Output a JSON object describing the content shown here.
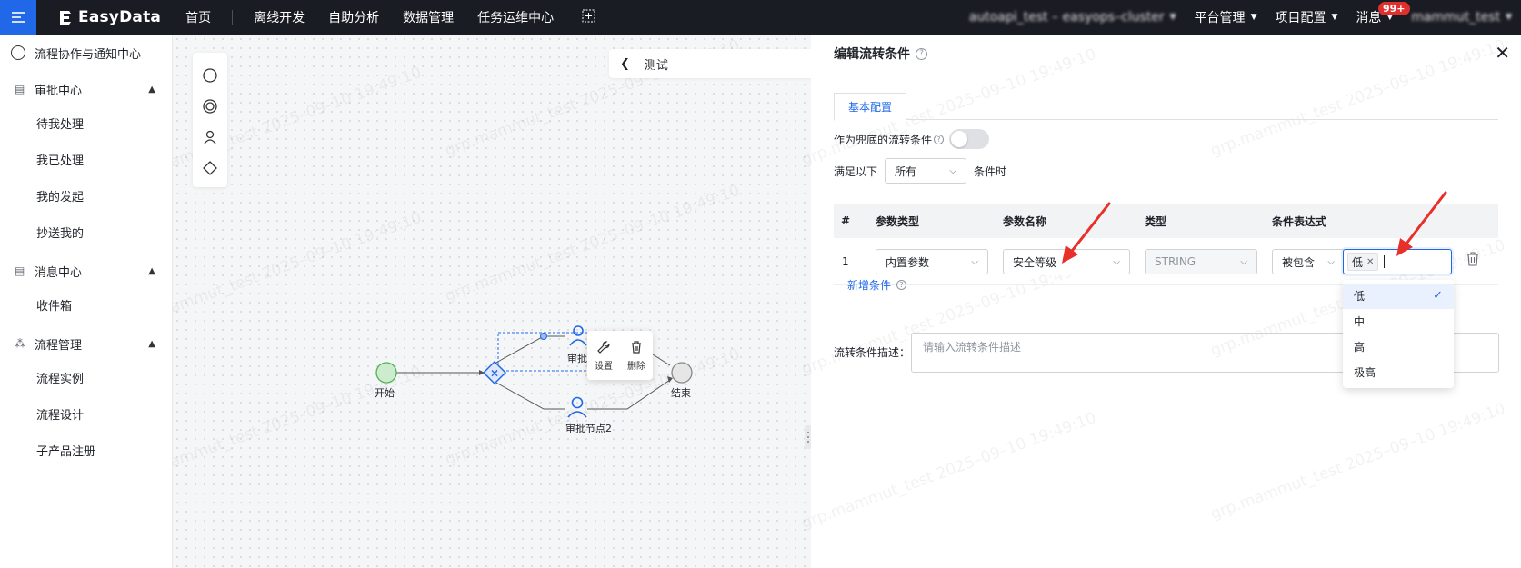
{
  "topbar": {
    "logo": "EasyData",
    "nav": [
      "首页",
      "离线开发",
      "自助分析",
      "数据管理",
      "任务运维中心"
    ],
    "cluster": "autoapi_test – easyops–cluster",
    "platform_admin": "平台管理",
    "project_config": "项目配置",
    "messages": "消息",
    "badge": "99+",
    "user": "mammut_test"
  },
  "sidebar": {
    "header": "流程协作与通知中心",
    "groups": [
      {
        "label": "审批中心",
        "items": [
          "待我处理",
          "我已处理",
          "我的发起",
          "抄送我的"
        ]
      },
      {
        "label": "消息中心",
        "items": [
          "收件箱"
        ]
      },
      {
        "label": "流程管理",
        "items": [
          "流程实例",
          "流程设计",
          "子产品注册"
        ]
      }
    ]
  },
  "canvas": {
    "test_label": "测试",
    "nodes": {
      "start": "开始",
      "end": "结束",
      "approval1": "审批",
      "approval2": "审批节点2"
    },
    "popup": {
      "settings": "设置",
      "delete": "删除"
    },
    "watermark": "grp.mammut_test 2025–09–10 19:49:10"
  },
  "panel": {
    "title": "编辑流转条件",
    "tab": "基本配置",
    "fallback_label": "作为兜底的流转条件",
    "satisfy_prefix": "满足以下",
    "satisfy_value": "所有",
    "satisfy_suffix": "条件时",
    "table": {
      "headers": [
        "#",
        "参数类型",
        "参数名称",
        "类型",
        "条件表达式"
      ],
      "rows": [
        {
          "index": "1",
          "param_type": "内置参数",
          "param_name": "安全等级",
          "type": "STRING",
          "operator": "被包含",
          "tag": "低"
        }
      ]
    },
    "add_condition": "新增条件",
    "desc_label": "流转条件描述：",
    "desc_placeholder": "请输入流转条件描述"
  },
  "dropdown": {
    "options": [
      "低",
      "中",
      "高",
      "极高"
    ],
    "selected": "低"
  },
  "colors": {
    "primary": "#2168e8",
    "topbar": "#1a1c23",
    "annotation": "#e8302a"
  }
}
